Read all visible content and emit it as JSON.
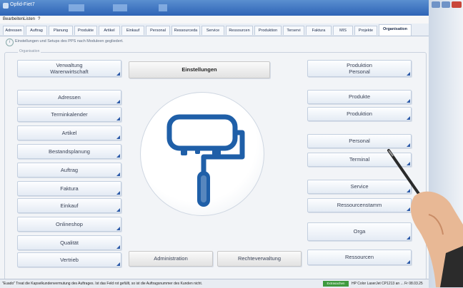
{
  "window": {
    "title": "Opfid-Fiet7"
  },
  "menu": {
    "items": [
      "Bearbeiten",
      "Listen",
      "?"
    ]
  },
  "tabs": [
    {
      "label": "Adressen"
    },
    {
      "label": "Auftrag"
    },
    {
      "label": "Planung"
    },
    {
      "label": "Produkte"
    },
    {
      "label": "Artikel"
    },
    {
      "label": "Einkauf"
    },
    {
      "label": "Personal"
    },
    {
      "label": "Ressourceda"
    },
    {
      "label": "Service"
    },
    {
      "label": "Ressourcen"
    },
    {
      "label": "Produktion"
    },
    {
      "label": "Terservi"
    },
    {
      "label": "Faktura"
    },
    {
      "label": "MIS"
    },
    {
      "label": "Projekte"
    },
    {
      "label": "Organisation"
    }
  ],
  "info": {
    "text": "Einstellungen und Setups des PPS nach Moduleen gegliedert."
  },
  "group": {
    "legend": "Organisation"
  },
  "top": {
    "left_line1": "Verwaltung",
    "left_line2": "Warenwirtschaft",
    "center": "Einstellungen",
    "right_line1": "Produktion",
    "right_line2": "Personal"
  },
  "left_buttons": [
    "Adressen",
    "Terminkalender",
    "Artikel",
    "Bestandsplanung",
    "Auftrag",
    "Faktura",
    "Einkauf",
    "Onlineshop",
    "Qualität",
    "Vertrieb"
  ],
  "right_buttons": [
    "Produkte",
    "Produktion",
    "Personal",
    "Terminal",
    "Service",
    "Ressourcenstamm",
    "Orga",
    "Ressourcen"
  ],
  "bottom": {
    "administration": "Administration",
    "rechteverwaltung": "Rechteverwaltung"
  },
  "status": {
    "message": "\"Euado\" Treat die Kapselkundenvermutung des Auftrages. Ist das Feld rot gefüllt, so ist die Auftragsnummer des Kunden nicht.",
    "green_label": "Extrasachen",
    "printer": "HP Color LaserJet CP1213 an ... Fr 08.03.25"
  },
  "icon": {
    "name": "paint-roller-icon",
    "color": "#1f5fa8"
  }
}
